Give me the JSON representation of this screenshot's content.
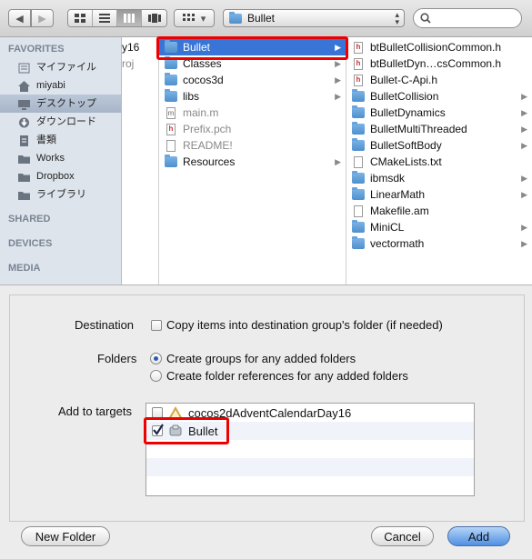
{
  "toolbar": {
    "back_glyph": "◀",
    "forward_glyph": "▶",
    "view_modes": [
      "icon-view",
      "list-view",
      "column-view",
      "coverflow-view"
    ],
    "arrange_label": "▾",
    "location": "Bullet",
    "search_placeholder": ""
  },
  "sidebar": {
    "favorites_header": "FAVORITES",
    "items": [
      {
        "label": "マイファイル",
        "icon": "myfiles-icon"
      },
      {
        "label": "miyabi",
        "icon": "home-icon"
      },
      {
        "label": "デスクトップ",
        "icon": "desktop-icon"
      },
      {
        "label": "ダウンロード",
        "icon": "downloads-icon"
      },
      {
        "label": "書類",
        "icon": "documents-icon"
      },
      {
        "label": "Works",
        "icon": "folder-icon"
      },
      {
        "label": "Dropbox",
        "icon": "folder-icon"
      },
      {
        "label": "ライブラリ",
        "icon": "folder-icon"
      }
    ],
    "shared_header": "SHARED",
    "devices_header": "DEVICES",
    "media_header": "MEDIA"
  },
  "column0": {
    "fragment1": "y16",
    "fragment2": "roj"
  },
  "column1": [
    {
      "label": "Bullet",
      "kind": "folder",
      "arrow": "▶"
    },
    {
      "label": "Classes",
      "kind": "folder",
      "arrow": "▶"
    },
    {
      "label": "cocos3d",
      "kind": "folder",
      "arrow": "▶"
    },
    {
      "label": "libs",
      "kind": "folder",
      "arrow": "▶"
    },
    {
      "label": "main.m",
      "kind": "file-m"
    },
    {
      "label": "Prefix.pch",
      "kind": "file-h"
    },
    {
      "label": "README!",
      "kind": "file"
    },
    {
      "label": "Resources",
      "kind": "folder",
      "arrow": "▶"
    }
  ],
  "column2": [
    {
      "label": "btBulletCollisionCommon.h",
      "kind": "file-h"
    },
    {
      "label": "btBulletDyn…csCommon.h",
      "kind": "file-h"
    },
    {
      "label": "Bullet-C-Api.h",
      "kind": "file-h"
    },
    {
      "label": "BulletCollision",
      "kind": "folder",
      "arrow": "▶"
    },
    {
      "label": "BulletDynamics",
      "kind": "folder",
      "arrow": "▶"
    },
    {
      "label": "BulletMultiThreaded",
      "kind": "folder",
      "arrow": "▶"
    },
    {
      "label": "BulletSoftBody",
      "kind": "folder",
      "arrow": "▶"
    },
    {
      "label": "CMakeLists.txt",
      "kind": "file"
    },
    {
      "label": "ibmsdk",
      "kind": "folder",
      "arrow": "▶"
    },
    {
      "label": "LinearMath",
      "kind": "folder",
      "arrow": "▶"
    },
    {
      "label": "Makefile.am",
      "kind": "file"
    },
    {
      "label": "MiniCL",
      "kind": "folder",
      "arrow": "▶"
    },
    {
      "label": "vectormath",
      "kind": "folder",
      "arrow": "▶"
    }
  ],
  "options": {
    "destination_label": "Destination",
    "destination_option": "Copy items into destination group's folder (if needed)",
    "destination_checked": false,
    "folders_label": "Folders",
    "folders_option_groups": "Create groups for any added folders",
    "folders_option_references": "Create folder references for any added folders",
    "folders_selected": "groups",
    "targets_label": "Add to targets",
    "targets": [
      {
        "label": "cocos2dAdventCalendarDay16",
        "checked": false,
        "icon": "app-target-icon"
      },
      {
        "label": "Bullet",
        "checked": true,
        "icon": "library-target-icon"
      }
    ]
  },
  "buttons": {
    "new_folder": "New Folder",
    "cancel": "Cancel",
    "add": "Add"
  },
  "colors": {
    "selection": "#3875d7",
    "highlight_box": "#e00000",
    "default_button": "#4f90e3"
  }
}
